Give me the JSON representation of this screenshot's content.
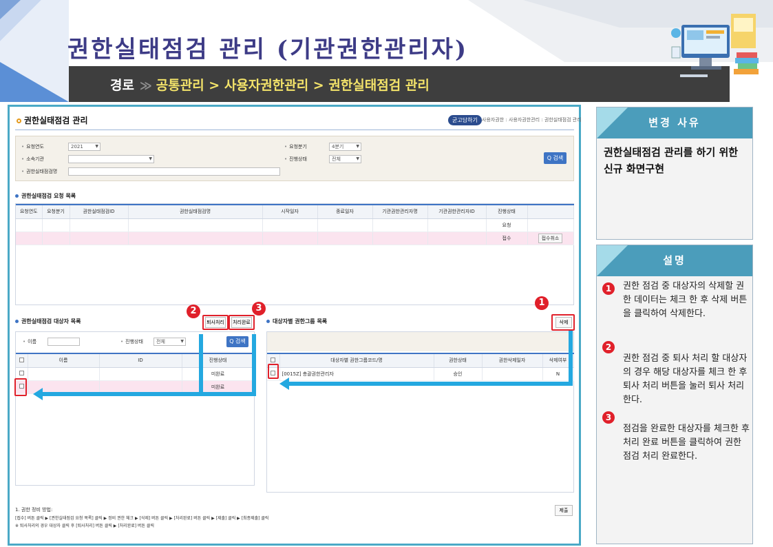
{
  "header": {
    "title": "권한실태점검 관리 (기관권한관리자)",
    "path_label": "경로",
    "path": "공통관리 > 사용자권한관리 > 권한실태점검 관리"
  },
  "screen": {
    "page_title": "권한실태점검 관리",
    "guide_button": "굳고담하기",
    "breadcrumb": "사용자권한 : 사용자권한관리 : 권한실태점검 관리",
    "search": {
      "year_label": "요청연도",
      "year_value": "2021",
      "quarter_label": "요청분기",
      "quarter_value": "4분기",
      "org_label": "소속기관",
      "status_label": "진행상태",
      "status_value": "전체",
      "name_label": "권한실태점검명",
      "search_button": "Q 검색"
    },
    "request_list": {
      "title": "권한실태점검 요청 목록",
      "columns": [
        "요청연도",
        "요청분기",
        "권한실태점검ID",
        "권한실태점검명",
        "시작일자",
        "종료일자",
        "기관권한관리자명",
        "기관권한관리자ID",
        "진행상태",
        ""
      ],
      "rows": [
        {
          "status": "요청",
          "action": ""
        },
        {
          "status": "접수",
          "action": "접수취소"
        }
      ]
    },
    "target_list": {
      "title": "권한실태점검 대상자 목록",
      "retire_button": "퇴사처리",
      "complete_button": "처리완료",
      "name_label": "이름",
      "status_label": "진행상태",
      "status_value": "전체",
      "search_button": "Q 검색",
      "columns": [
        "",
        "이름",
        "ID",
        "진행상태"
      ],
      "rows": [
        {
          "status": "미완료"
        },
        {
          "status": "미완료"
        }
      ]
    },
    "group_list": {
      "title": "대상자별 권한그룹 목록",
      "delete_button": "삭제",
      "columns": [
        "",
        "대상자별 권한그룹코드/명",
        "권한상태",
        "권한삭제일자",
        "삭제여부"
      ],
      "rows": [
        {
          "code": "[0015Z] 총괄권한관리자",
          "state": "승인",
          "date": "",
          "deleted": "N"
        }
      ]
    },
    "submit_button": "제출",
    "footnote": {
      "line1": "1. 권한 정비 방법:",
      "line2": "[접수] 버튼 클릭 ▶ [권한실태점검 요청 목록] 클릭 ▶ 정비 권한 체크 ▶ [삭제] 버튼 클릭 ▶ [처리완료] 버튼 클릭 ▶ [제출] 클릭 ▶ [최종제출] 클릭",
      "line3": "※ 퇴사처리의 경우 대상자 클릭 후 [퇴사처리] 버튼 클릭 ▶ [처리완료] 버튼 클릭"
    }
  },
  "callouts": {
    "n1": "1",
    "n2": "2",
    "n3": "3"
  },
  "right_panel": {
    "reason_title": "변경 사유",
    "reason_text": "권한실태점검 관리를 하기 위한 신규 화면구현",
    "desc_title": "설명",
    "items": [
      {
        "num": "1",
        "text": "권한 점검 중 대상자의 삭제할 권한 데이터는 체크 한 후 삭제 버튼을 클릭하여 삭제한다."
      },
      {
        "num": "2",
        "text": "권한 점검 중 퇴사 처리 할 대상자의 경우 해당 대상자를 체크 한 후 퇴사 처리 버튼을 눌러 퇴사 처리 한다."
      },
      {
        "num": "3",
        "text": "점검을 완료한 대상자를 체크한 후 처리 완료 버튼을 클릭하여 권한 점검 처리 완료한다."
      }
    ]
  },
  "colors": {
    "title": "#3d3b86",
    "path": "#f3e36a",
    "accent_blue": "#4aa9c6",
    "callout_red": "#e0202a",
    "arrow_blue": "#24a8e0"
  }
}
